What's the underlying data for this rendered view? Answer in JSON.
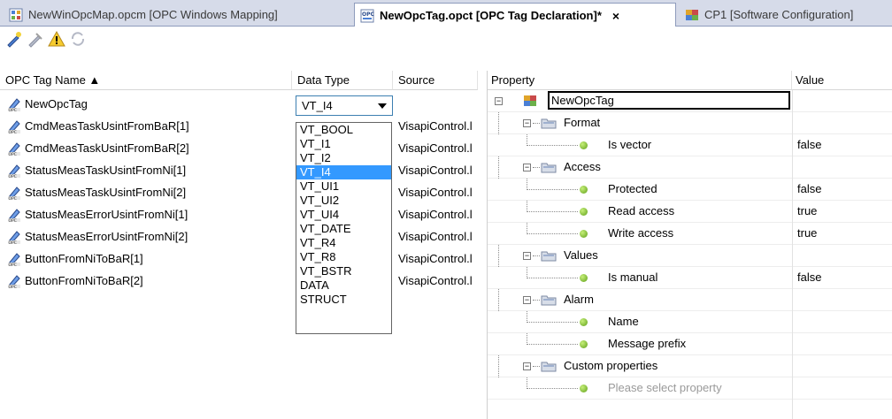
{
  "tabs": [
    {
      "label": "NewWinOpcMap.opcm [OPC Windows Mapping]",
      "active": false,
      "icon": "opc-map-icon"
    },
    {
      "label": "NewOpcTag.opct [OPC Tag Declaration]*",
      "active": true,
      "icon": "opc-tag-declaration-icon",
      "close": "×"
    },
    {
      "label": "CP1 [Software Configuration]",
      "active": false,
      "icon": "software-configuration-icon"
    }
  ],
  "toolbar": {
    "icons": [
      "add-tag-icon",
      "edit-tag-icon",
      "warning-icon",
      "refresh-icon"
    ]
  },
  "tag_table": {
    "columns": {
      "name": "OPC Tag Name ▲",
      "type": "Data Type",
      "source": "Source"
    },
    "rows": [
      {
        "name": "NewOpcTag",
        "source": ""
      },
      {
        "name": "CmdMeasTaskUsintFromBaR[1]",
        "source": "VisapiControl.l"
      },
      {
        "name": "CmdMeasTaskUsintFromBaR[2]",
        "source": "VisapiControl.l"
      },
      {
        "name": "StatusMeasTaskUsintFromNi[1]",
        "source": "VisapiControl.l"
      },
      {
        "name": "StatusMeasTaskUsintFromNi[2]",
        "source": "VisapiControl.l"
      },
      {
        "name": "StatusMeasErrorUsintFromNi[1]",
        "source": "VisapiControl.l"
      },
      {
        "name": "StatusMeasErrorUsintFromNi[2]",
        "source": "VisapiControl.l"
      },
      {
        "name": "ButtonFromNiToBaR[1]",
        "source": "VisapiControl.l"
      },
      {
        "name": "ButtonFromNiToBaR[2]",
        "source": "VisapiControl.l"
      }
    ]
  },
  "datatype_dropdown": {
    "selected": "VT_I4",
    "options": [
      "VT_BOOL",
      "VT_I1",
      "VT_I2",
      "VT_I4",
      "VT_UI1",
      "VT_UI2",
      "VT_UI4",
      "VT_DATE",
      "VT_R4",
      "VT_R8",
      "VT_BSTR",
      "DATA",
      "STRUCT"
    ]
  },
  "property_grid": {
    "columns": {
      "property": "Property",
      "value": "Value"
    },
    "root": "NewOpcTag",
    "rows": [
      {
        "label": "Format",
        "value": "",
        "kind": "group"
      },
      {
        "label": "Is vector",
        "value": "false",
        "kind": "prop"
      },
      {
        "label": "Access",
        "value": "",
        "kind": "group"
      },
      {
        "label": "Protected",
        "value": "false",
        "kind": "prop"
      },
      {
        "label": "Read access",
        "value": "true",
        "kind": "prop"
      },
      {
        "label": "Write access",
        "value": "true",
        "kind": "prop"
      },
      {
        "label": "Values",
        "value": "",
        "kind": "group"
      },
      {
        "label": "Is manual",
        "value": "false",
        "kind": "prop"
      },
      {
        "label": "Alarm",
        "value": "",
        "kind": "group"
      },
      {
        "label": "Name",
        "value": "",
        "kind": "prop"
      },
      {
        "label": "Message prefix",
        "value": "",
        "kind": "prop"
      },
      {
        "label": "Custom properties",
        "value": "",
        "kind": "group"
      },
      {
        "label": "Please select property",
        "value": "",
        "kind": "placeholder"
      }
    ]
  },
  "colors": {
    "tabbar_bg": "#d6dbe9",
    "selection": "#3399ff",
    "dropdown_border": "#3c7fb1"
  }
}
